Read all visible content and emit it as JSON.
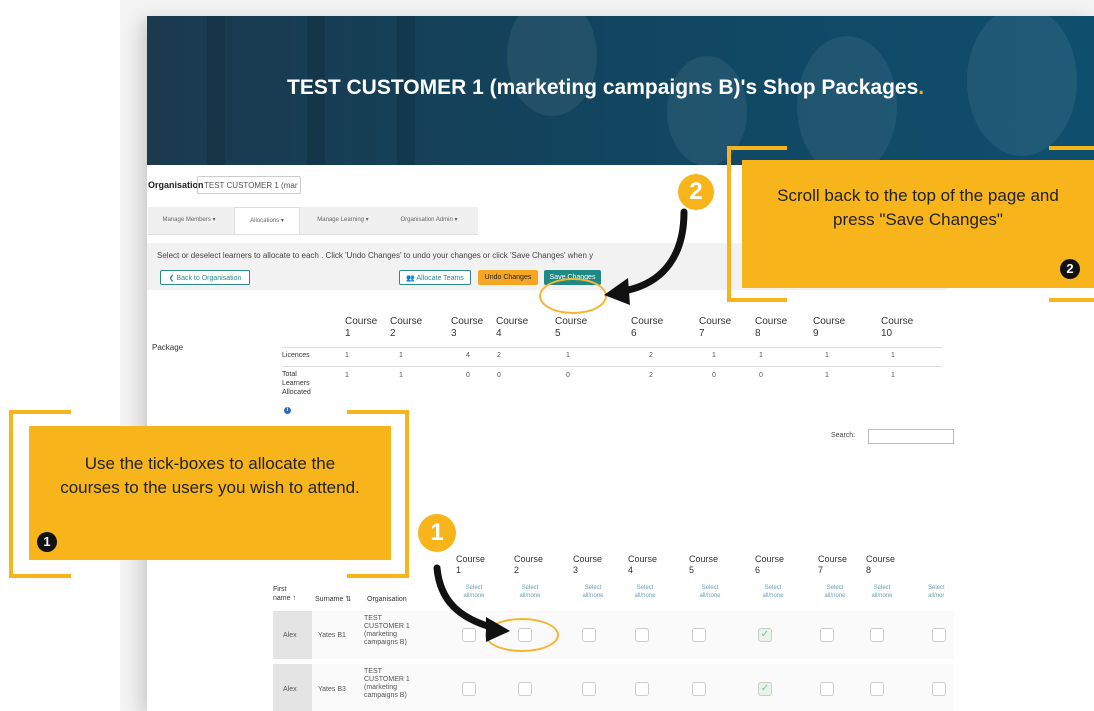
{
  "hero": {
    "title": "TEST CUSTOMER 1 (marketing campaigns B)'s Shop Packages",
    "title_dot": "."
  },
  "org": {
    "label": "Organisation",
    "value": "TEST CUSTOMER 1 (mar"
  },
  "tabs": [
    {
      "label": "Manage Members ▾"
    },
    {
      "label": "Allocations ▾"
    },
    {
      "label": "Manage Learning ▾"
    },
    {
      "label": "Organisation Admin ▾"
    }
  ],
  "infobar": {
    "text": "Select or deselect learners to allocate to each . Click 'Undo Changes' to undo your changes or click 'Save Changes' when y",
    "back_label": "❮ Back to Organisation",
    "allocate_label": "👥 Allocate Teams",
    "undo_label": "Undo Changes",
    "save_label": "Save Changes"
  },
  "packages": {
    "row_label": "Package",
    "licences_label": "Licences",
    "total_label": "Total Learners Allocated",
    "total_label_lines": [
      "Total",
      "Learners",
      "Allocated"
    ],
    "courses": [
      {
        "name": "Course",
        "num": "1",
        "licences": "1",
        "allocated": "1"
      },
      {
        "name": "Course",
        "num": "2",
        "licences": "1",
        "allocated": "1"
      },
      {
        "name": "Course",
        "num": "3",
        "licences": "4",
        "allocated": "0"
      },
      {
        "name": "Course",
        "num": "4",
        "licences": "2",
        "allocated": "0"
      },
      {
        "name": "Course",
        "num": "5",
        "licences": "1",
        "allocated": "0"
      },
      {
        "name": "Course",
        "num": "6",
        "licences": "2",
        "allocated": "2"
      },
      {
        "name": "Course",
        "num": "7",
        "licences": "1",
        "allocated": "0"
      },
      {
        "name": "Course",
        "num": "8",
        "licences": "1",
        "allocated": "0"
      },
      {
        "name": "Course",
        "num": "9",
        "licences": "1",
        "allocated": "1"
      },
      {
        "name": "Course",
        "num": "10",
        "licences": "1",
        "allocated": "1"
      }
    ]
  },
  "search": {
    "label": "Search:"
  },
  "learners": {
    "first_name_lines": [
      "First",
      "name ↑"
    ],
    "surname_label": "Surname ⇅",
    "organisation_label": "Organisation",
    "select_all_lines": [
      "Select",
      "all/none"
    ],
    "select_all_trunc": [
      "Select",
      "all/nor"
    ],
    "courses": [
      {
        "name": "Course",
        "num": "1"
      },
      {
        "name": "Course",
        "num": "2"
      },
      {
        "name": "Course",
        "num": "3"
      },
      {
        "name": "Course",
        "num": "4"
      },
      {
        "name": "Course",
        "num": "5"
      },
      {
        "name": "Course",
        "num": "6"
      },
      {
        "name": "Course",
        "num": "7"
      },
      {
        "name": "Course",
        "num": "8"
      }
    ],
    "rows": [
      {
        "first": "Alex",
        "surname": "Yates B1",
        "org_lines": [
          "TEST",
          "CUSTOMER 1",
          "(marketing",
          "campaigns B)"
        ],
        "checks": [
          false,
          false,
          false,
          false,
          false,
          true,
          false,
          false,
          false
        ]
      },
      {
        "first": "Alex",
        "surname": "Yates B3",
        "org_lines": [
          "TEST",
          "CUSTOMER 1",
          "(marketing",
          "campaigns B)"
        ],
        "checks": [
          false,
          false,
          false,
          false,
          false,
          true,
          false,
          false,
          false
        ]
      }
    ]
  },
  "callouts": {
    "right": {
      "text": "Scroll back to the top of the page and press \"Save Changes\"",
      "marker": "2",
      "badge": "2"
    },
    "left": {
      "text": "Use the tick-boxes to allocate the courses to the users you wish to attend.",
      "marker": "1",
      "badge": "1"
    }
  },
  "colors": {
    "accent": "#f7b41b",
    "teal": "#1f8a85",
    "hero": "#12445e"
  }
}
